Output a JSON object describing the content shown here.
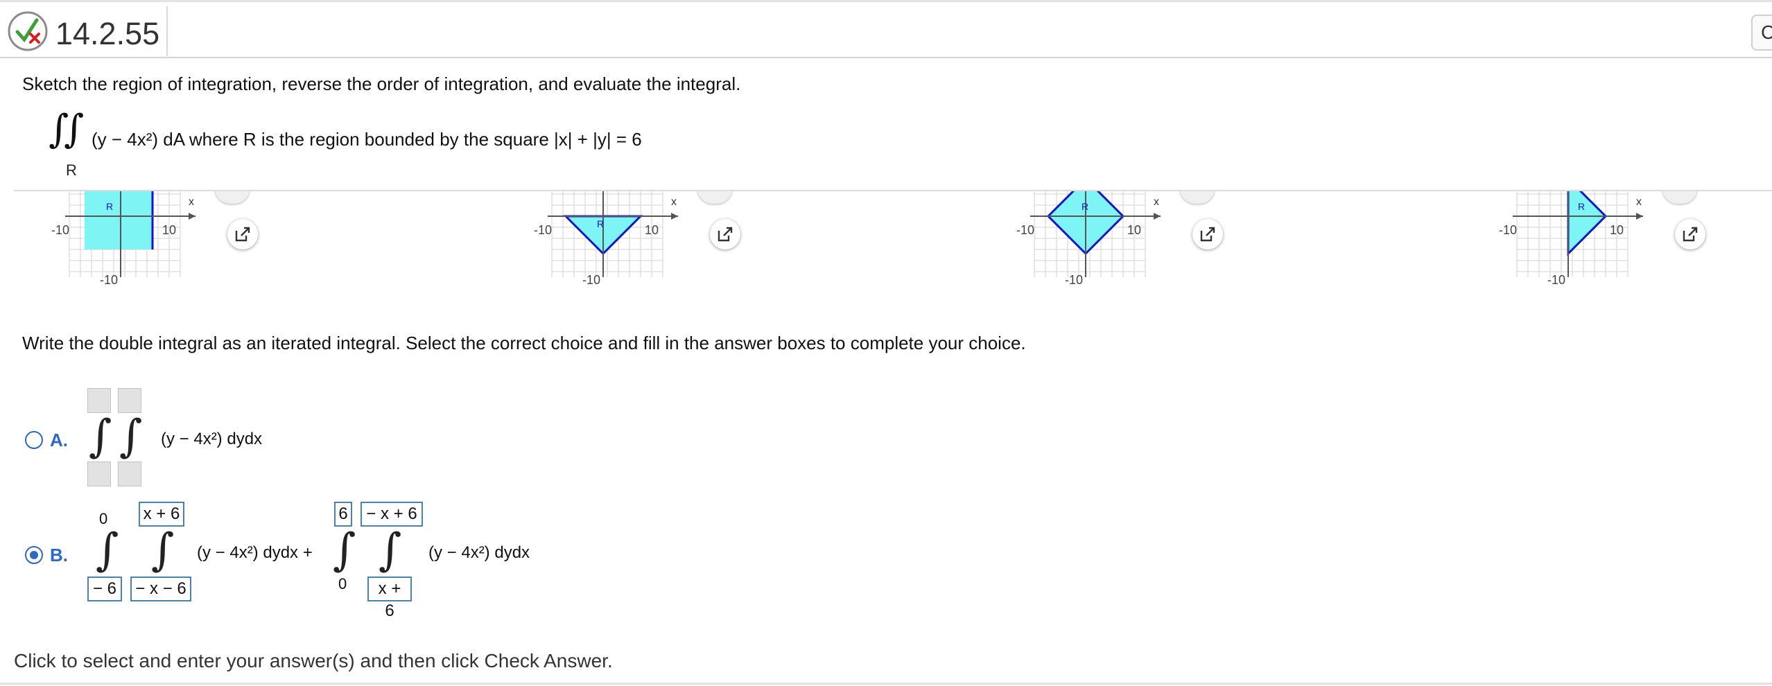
{
  "header": {
    "problem_number": "14.2.55",
    "status_icon": "partial-check-icon",
    "right_button_label": "C"
  },
  "question": {
    "instruction": "Sketch the region of integration, reverse the order of integration, and evaluate the integral.",
    "integrand": "(y − 4x²) dA where R is the region bounded by the square |x| + |y| = 6",
    "region_label": "R"
  },
  "graphs": [
    {
      "x_label": "x",
      "region": "R",
      "ticks": [
        "-10",
        "10",
        "-10"
      ]
    },
    {
      "x_label": "x",
      "region": "R",
      "ticks": [
        "-10",
        "10",
        "-10"
      ]
    },
    {
      "x_label": "x",
      "region": "R",
      "ticks": [
        "-10",
        "10",
        "-10"
      ]
    },
    {
      "x_label": "x",
      "region": "R",
      "ticks": [
        "-10",
        "10",
        "-10"
      ]
    }
  ],
  "prompt": "Write the double integral as an iterated integral. Select the correct choice and fill in the answer boxes to complete your choice.",
  "choices": {
    "a": {
      "letter": "A.",
      "integrand": "(y − 4x²) dydx",
      "selected": false
    },
    "b": {
      "letter": "B.",
      "selected": true,
      "first": {
        "outer_upper": "0",
        "outer_lower": "− 6",
        "inner_upper": "x + 6",
        "inner_lower": "− x − 6",
        "integrand": "(y − 4x²) dydx +"
      },
      "second": {
        "outer_upper": "6",
        "outer_lower": "0",
        "inner_upper": "− x + 6",
        "inner_lower": "x + 6",
        "integrand": "(y − 4x²) dydx"
      }
    }
  },
  "footer": "Click to select and enter your answer(s) and then click Check Answer.",
  "colors": {
    "accent": "#2d68c4",
    "region_fill": "#7ff4f4",
    "region_stroke": "#1414c8",
    "answer_border": "#4a83a6"
  }
}
